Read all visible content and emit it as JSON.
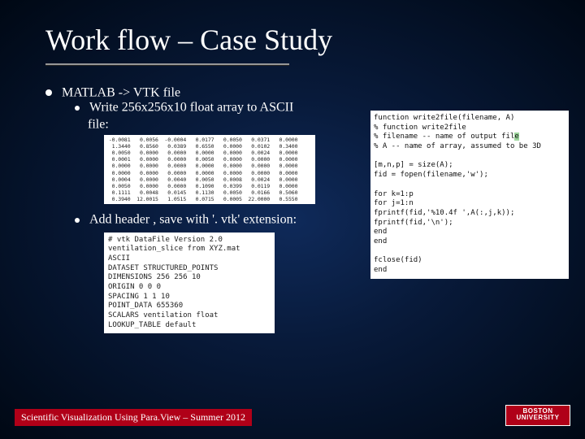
{
  "title": "Work flow – Case Study",
  "bullets": {
    "l1": "MATLAB -> VTK file",
    "l2a": "Write 256x256x10 float array to ASCII",
    "l2a_cont": "file:",
    "l2b": "Add header , save  with '. vtk' extension:"
  },
  "numtable": [
    " -0.0081   0.0056  -0.0004   0.0177   0.0050   0.0371   0.0000",
    "  1.3440   0.8560   0.0389   0.6550   0.0000   0.0102   0.3400",
    "  0.0050   0.0000   0.0000   0.0000   0.0000   0.0024   0.0000",
    "  0.0001   0.0000   0.0000   0.0050   0.0000   0.0000   0.0000",
    "  0.0000   0.0000   0.0000   0.0000   0.0000   0.0000   0.0000",
    "  0.0000   0.0000   0.0000   0.0000   0.0000   0.0000   0.0000",
    "  0.0004   0.0000   0.0040   0.0050   0.0008   0.0024   0.0000",
    "  0.0050   0.0000   0.0000   0.1090   0.0399   0.0119   0.0000",
    "  0.1111   0.0048   0.0145   0.1130   0.0050   0.0166   0.5060",
    "  0.3940  12.0015   1.0515   0.0715   0.0005  22.0000   0.5550"
  ],
  "code": {
    "l1": "function write2file(filename, A)",
    "l2": "% function write2file",
    "l3a": "% filename -- name of output fil",
    "l3b": "e",
    "l4": "%  A       -- name of array, assumed to be 3D",
    "l5": "",
    "l6": "[m,n,p] = size(A);",
    "l7": "fid = fopen(filename,'w');",
    "l8": "",
    "l9": "for k=1:p",
    "l10": "    for j=1:n",
    "l11": "        fprintf(fid,'%10.4f ',A(:,j,k));",
    "l12": "        fprintf(fid,'\\n');",
    "l13": "    end",
    "l14": "end",
    "l15": "",
    "l16": "fclose(fid)",
    "l17": "end"
  },
  "vtk": [
    "# vtk DataFile Version 2.0",
    "ventilation_slice from XYZ.mat",
    "ASCII",
    "DATASET STRUCTURED_POINTS",
    "DIMENSIONS 256 256 10",
    "ORIGIN 0 0 0",
    "SPACING 1 1 10",
    "",
    "POINT_DATA 655360",
    "SCALARS ventilation float",
    "LOOKUP_TABLE default"
  ],
  "footer": "Scientific Visualization Using Para.View – Summer 2012",
  "logo": {
    "line1": "BOSTON",
    "line2": "UNIVERSITY"
  }
}
